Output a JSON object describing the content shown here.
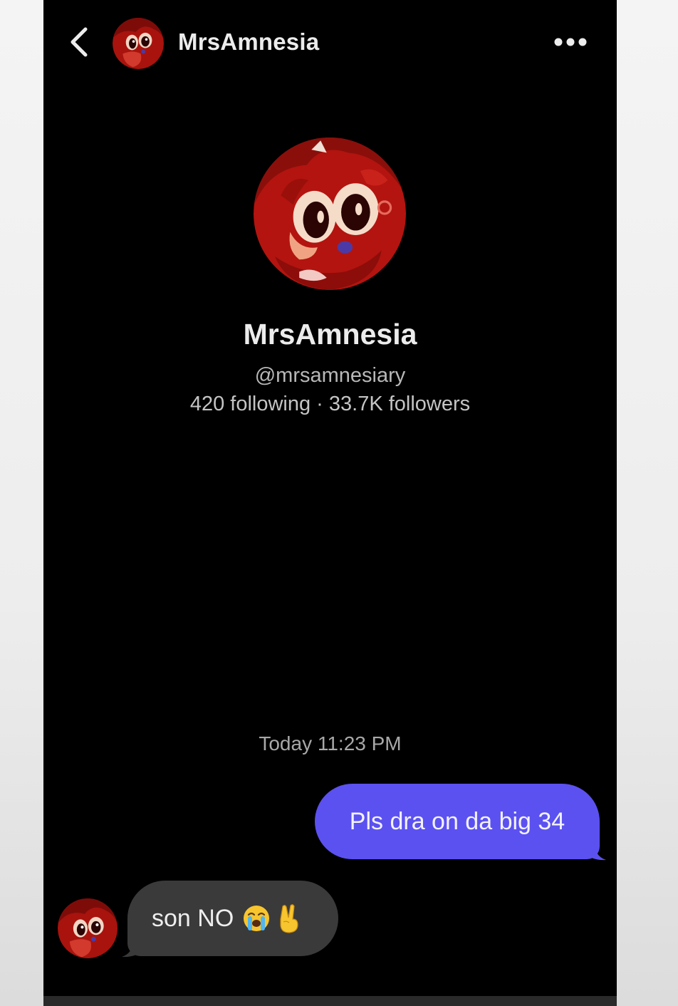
{
  "header": {
    "title": "MrsAmnesia",
    "back_icon": "chevron-left-icon",
    "more_icon": "more-horizontal-icon"
  },
  "profile": {
    "display_name": "MrsAmnesia",
    "handle": "@mrsamnesiary",
    "stats": "420 following · 33.7K followers",
    "avatar_icon": "cartoon-character-avatar"
  },
  "conversation": {
    "timestamp": "Today 11:23 PM",
    "messages": [
      {
        "direction": "outgoing",
        "text": "Pls dra on da big 34"
      },
      {
        "direction": "incoming",
        "text": "son NO",
        "emojis": [
          "loudly-crying-face-icon",
          "victory-hand-icon"
        ]
      }
    ]
  },
  "colors": {
    "background": "#000000",
    "outgoing_bubble": "#5b51f0",
    "incoming_bubble": "#3a3a3a",
    "avatar_red": "#b3140f"
  }
}
